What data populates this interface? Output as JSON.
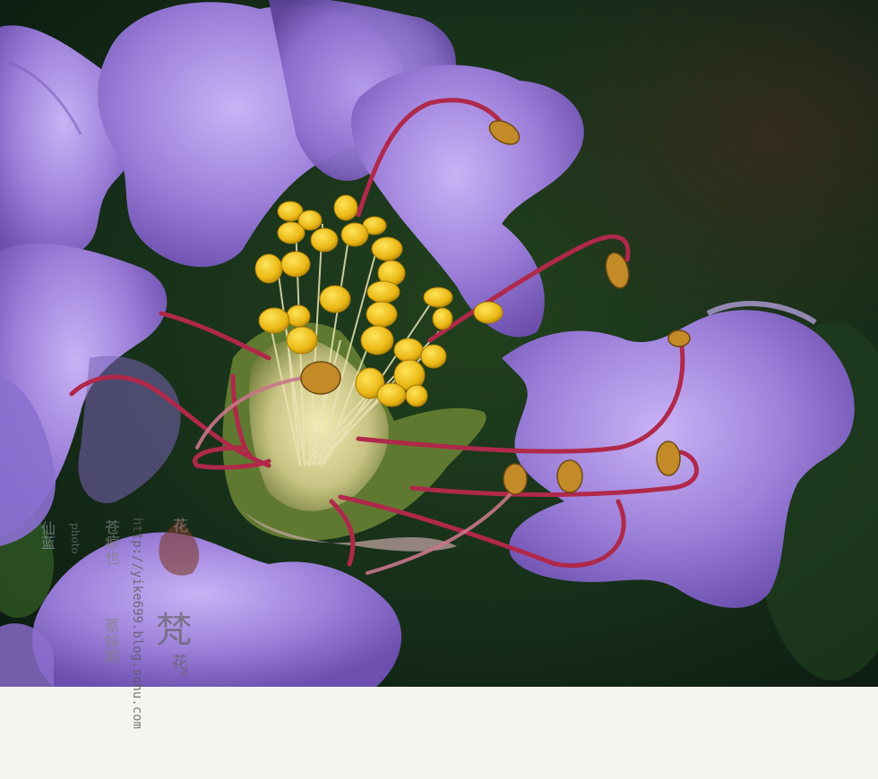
{
  "image": {
    "subject": "purple-flower-macro",
    "colors": {
      "petal": "#9b7fd6",
      "petal_light": "#c2a8f0",
      "petal_dark": "#6f54b0",
      "background": "#1b3419",
      "stamen_yellow": "#f1c21b",
      "filament_red": "#b22a4a",
      "caption_strip": "#f4f4f0"
    }
  },
  "watermark": {
    "url": "http://yike699.blog.sohu.com",
    "col1": "仙蓝",
    "col2": "photo",
    "col3": "苍痕也",
    "col4": "蔡妹妮",
    "col5": "花",
    "big_char": "梵",
    "big_sub": "花。"
  }
}
